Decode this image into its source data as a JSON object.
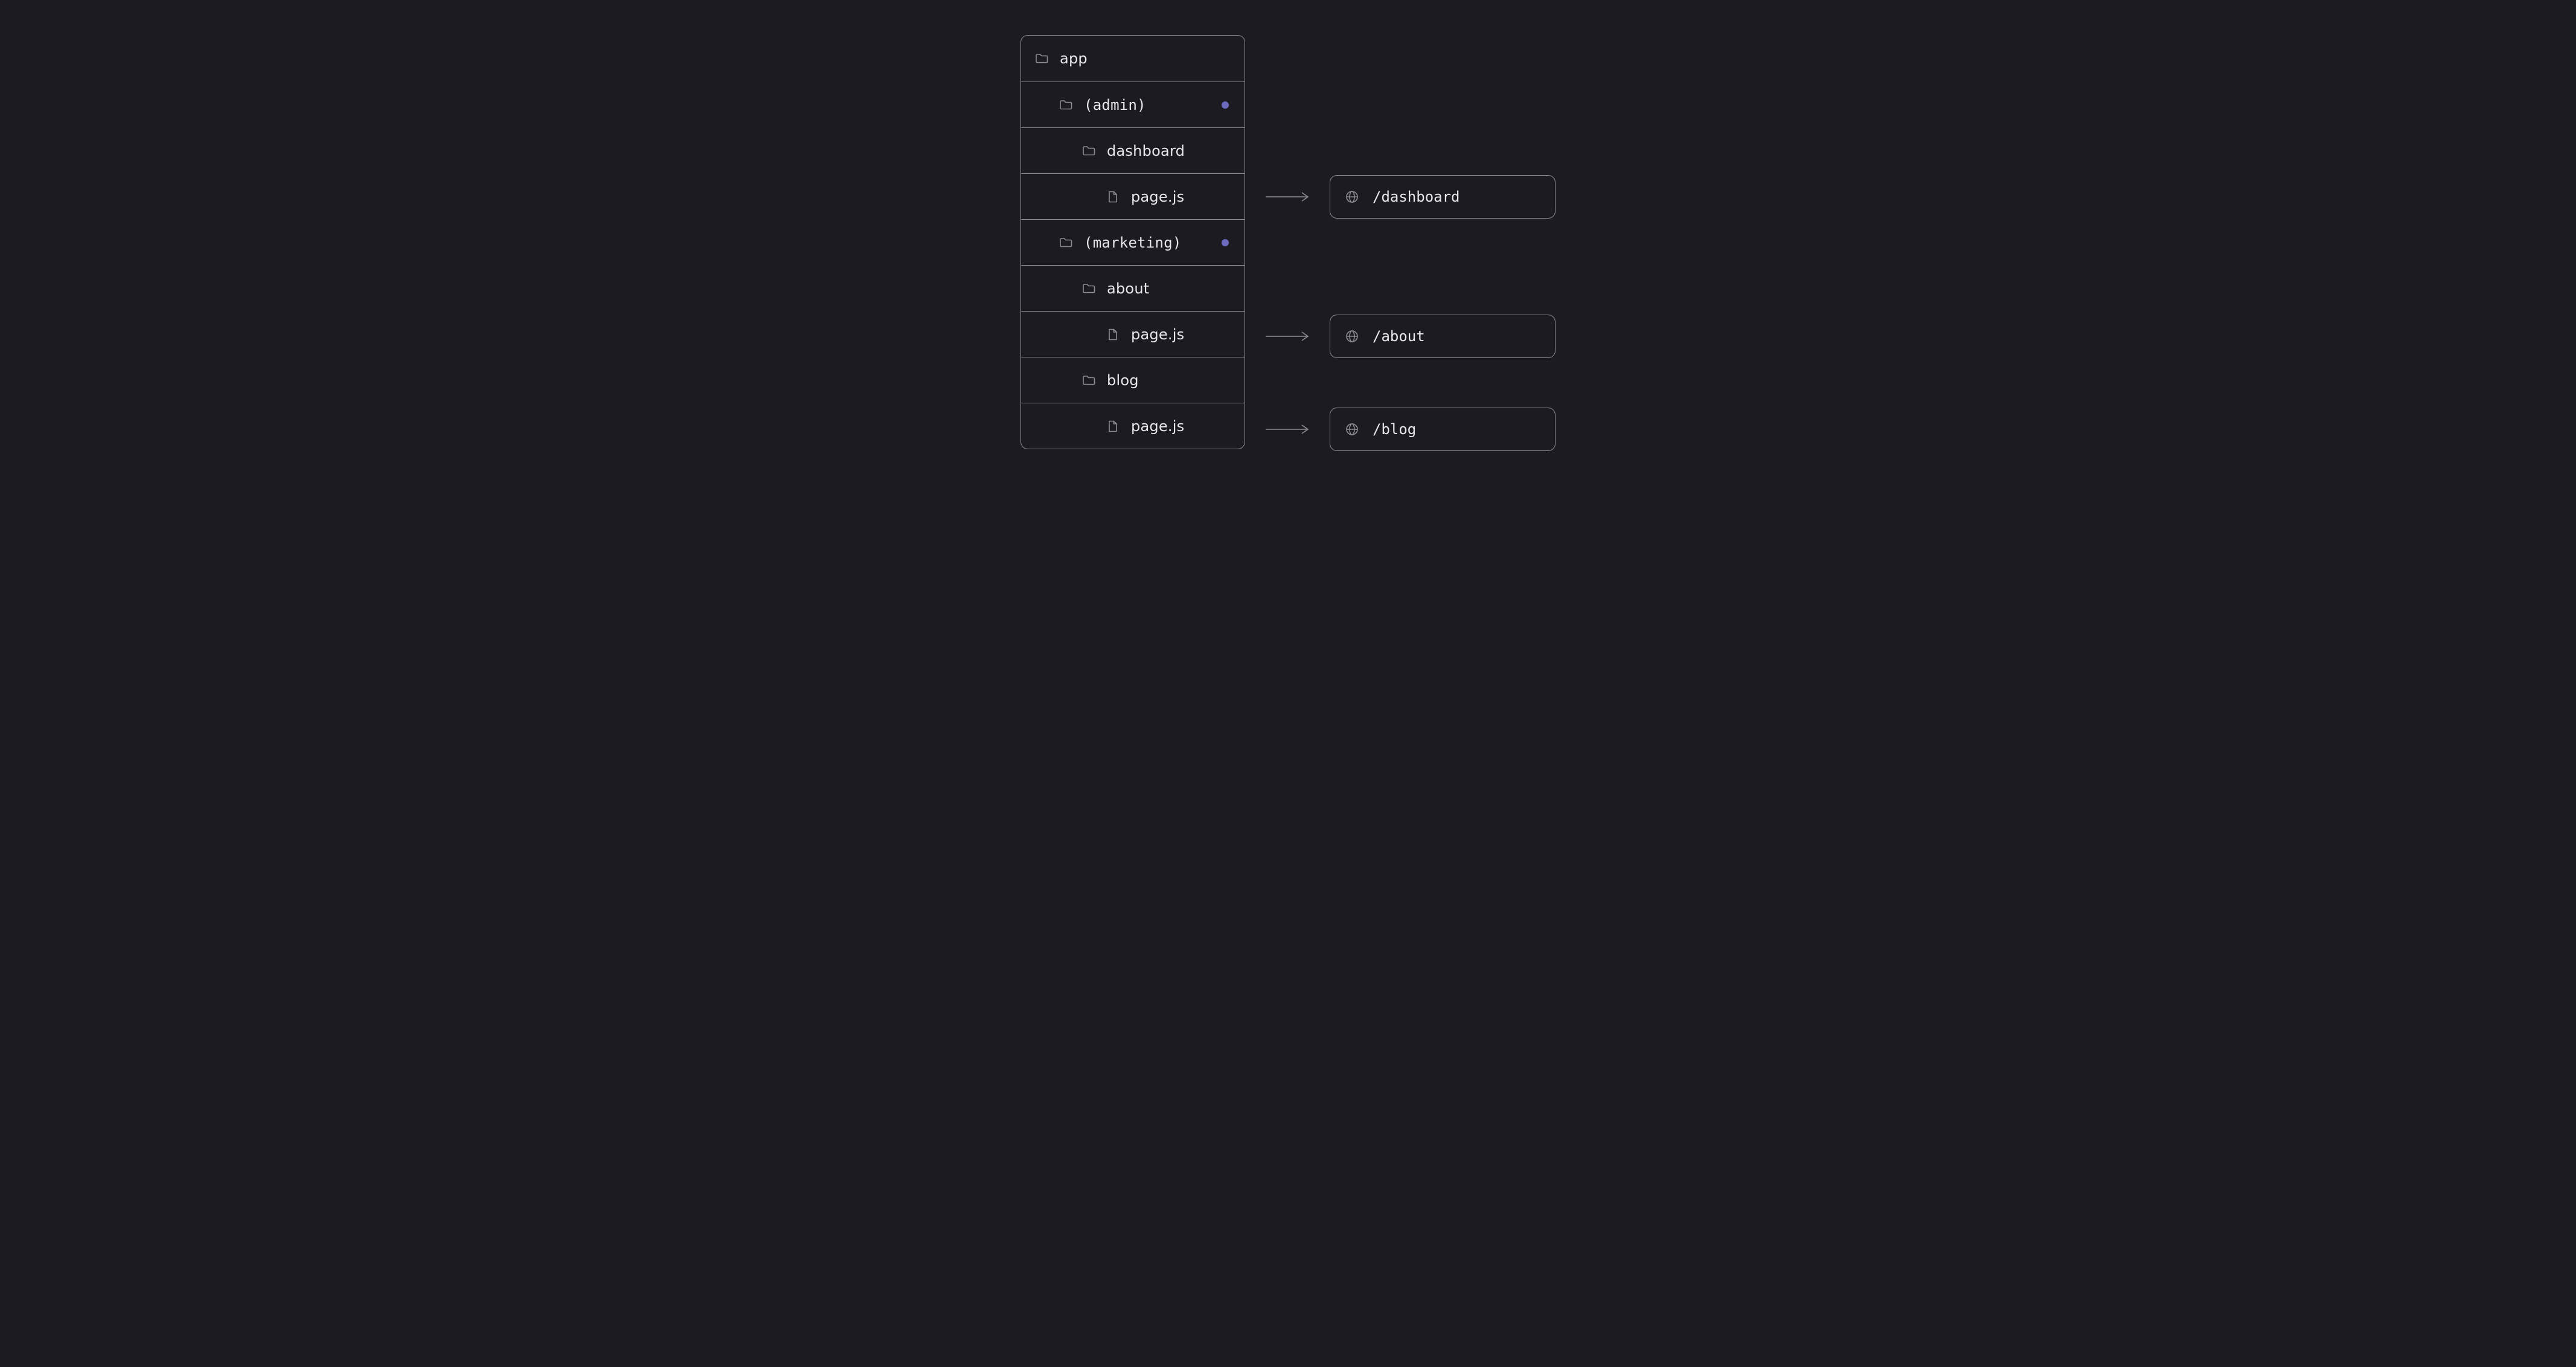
{
  "tree": {
    "rows": [
      {
        "icon": "folder",
        "label": "app",
        "indent": 0,
        "mono": false,
        "dot": false
      },
      {
        "icon": "folder",
        "label": "(admin)",
        "indent": 1,
        "mono": true,
        "dot": true
      },
      {
        "icon": "folder",
        "label": "dashboard",
        "indent": 2,
        "mono": false,
        "dot": false
      },
      {
        "icon": "file",
        "label": "page.js",
        "indent": 3,
        "mono": false,
        "dot": false
      },
      {
        "icon": "folder",
        "label": "(marketing)",
        "indent": 1,
        "mono": true,
        "dot": true
      },
      {
        "icon": "folder",
        "label": "about",
        "indent": 2,
        "mono": false,
        "dot": false
      },
      {
        "icon": "file",
        "label": "page.js",
        "indent": 3,
        "mono": false,
        "dot": false
      },
      {
        "icon": "folder",
        "label": "blog",
        "indent": 2,
        "mono": false,
        "dot": false
      },
      {
        "icon": "file",
        "label": "page.js",
        "indent": 3,
        "mono": false,
        "dot": false
      }
    ]
  },
  "urls": [
    "/dashboard",
    "/about",
    "/blog"
  ]
}
